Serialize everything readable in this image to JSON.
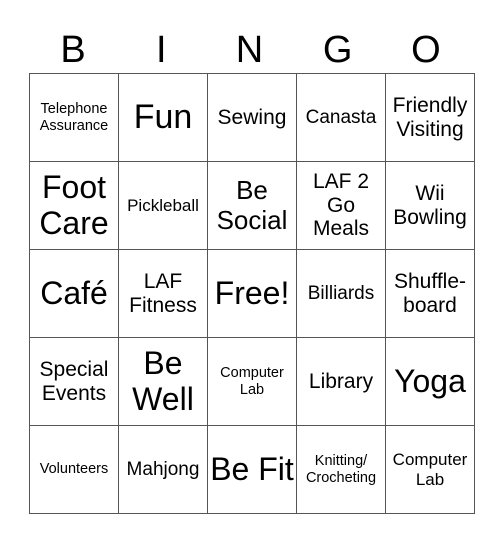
{
  "header": [
    "B",
    "I",
    "N",
    "G",
    "O"
  ],
  "cells": [
    [
      "Telephone Assurance",
      "Fun",
      "Sewing",
      "Canasta",
      "Friendly Visiting"
    ],
    [
      "Foot Care",
      "Pickleball",
      "Be Social",
      "LAF 2 Go Meals",
      "Wii Bowling"
    ],
    [
      "Café",
      "LAF Fitness",
      "Free!",
      "Billiards",
      "Shuffle-board"
    ],
    [
      "Special Events",
      "Be Well",
      "Computer Lab",
      "Library",
      "Yoga"
    ],
    [
      "Volunteers",
      "Mahjong",
      "Be Fit",
      "Knitting/ Crocheting",
      "Computer Lab"
    ]
  ]
}
